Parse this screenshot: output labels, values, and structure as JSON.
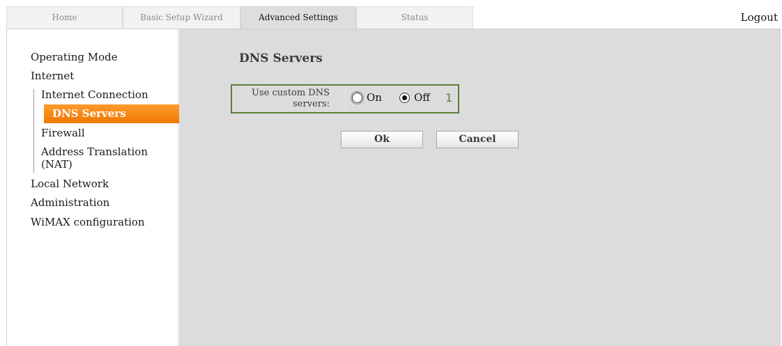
{
  "tabs": [
    {
      "label": "Home"
    },
    {
      "label": "Basic Setup Wizard"
    },
    {
      "label": "Advanced Settings",
      "active": true
    },
    {
      "label": "Status"
    }
  ],
  "logout_label": "Logout",
  "sidebar": {
    "items": [
      {
        "label": "Operating Mode"
      },
      {
        "label": "Internet"
      },
      {
        "label": "Internet Connection"
      },
      {
        "label": "DNS Servers",
        "active": true
      },
      {
        "label": "Firewall"
      },
      {
        "label": "Address Translation (NAT)"
      },
      {
        "label": "Local Network"
      },
      {
        "label": "Administration"
      },
      {
        "label": "WiMAX configuration"
      }
    ]
  },
  "main": {
    "title": "DNS Servers",
    "option": {
      "label": "Use custom DNS servers:",
      "choices": [
        {
          "label": "On",
          "checked": false
        },
        {
          "label": "Off",
          "checked": true
        }
      ],
      "annotation": "1"
    },
    "ok_label": "Ok",
    "cancel_label": "Cancel"
  },
  "colors": {
    "accent_orange": "#f07800",
    "annotation_green": "#5c7d3a",
    "content_bg": "#dcdcdc"
  }
}
